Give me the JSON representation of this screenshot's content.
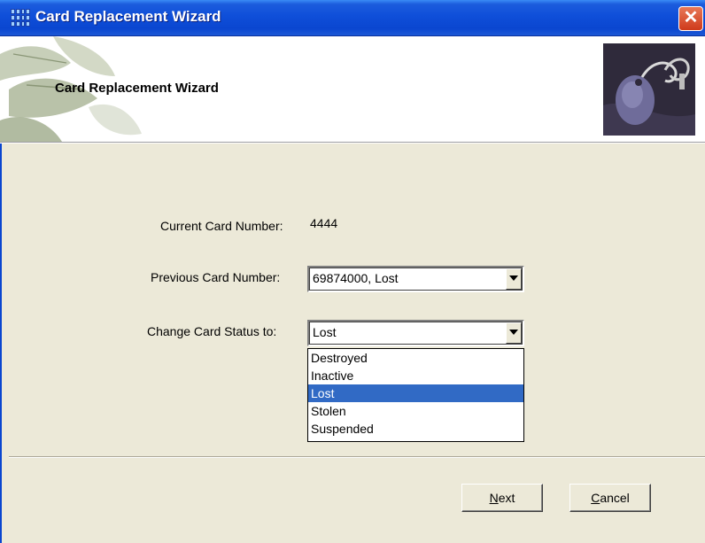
{
  "window": {
    "title": "Card Replacement Wizard",
    "close_glyph": "✕"
  },
  "header": {
    "title": "Card Replacement Wizard"
  },
  "form": {
    "current_card_label": "Current Card Number:",
    "current_card_value": "4444",
    "previous_card_label": "Previous Card Number:",
    "previous_card_value": "69874000, Lost",
    "status_label": "Change Card Status to:",
    "status_value": "Lost",
    "status_options": [
      "Destroyed",
      "Inactive",
      "Lost",
      "Stolen",
      "Suspended"
    ],
    "status_selected_index": 2
  },
  "buttons": {
    "next_accel": "N",
    "next_rest": "ext",
    "cancel_accel": "C",
    "cancel_rest": "ancel"
  },
  "colors": {
    "titlebar": "#0A46D0",
    "dialog_bg": "#ECE9D8",
    "selection": "#316AC5",
    "close_button": "#CF3A1B"
  },
  "icons": [
    "app-grid-icon",
    "close-icon",
    "dropdown-arrow-icon"
  ]
}
